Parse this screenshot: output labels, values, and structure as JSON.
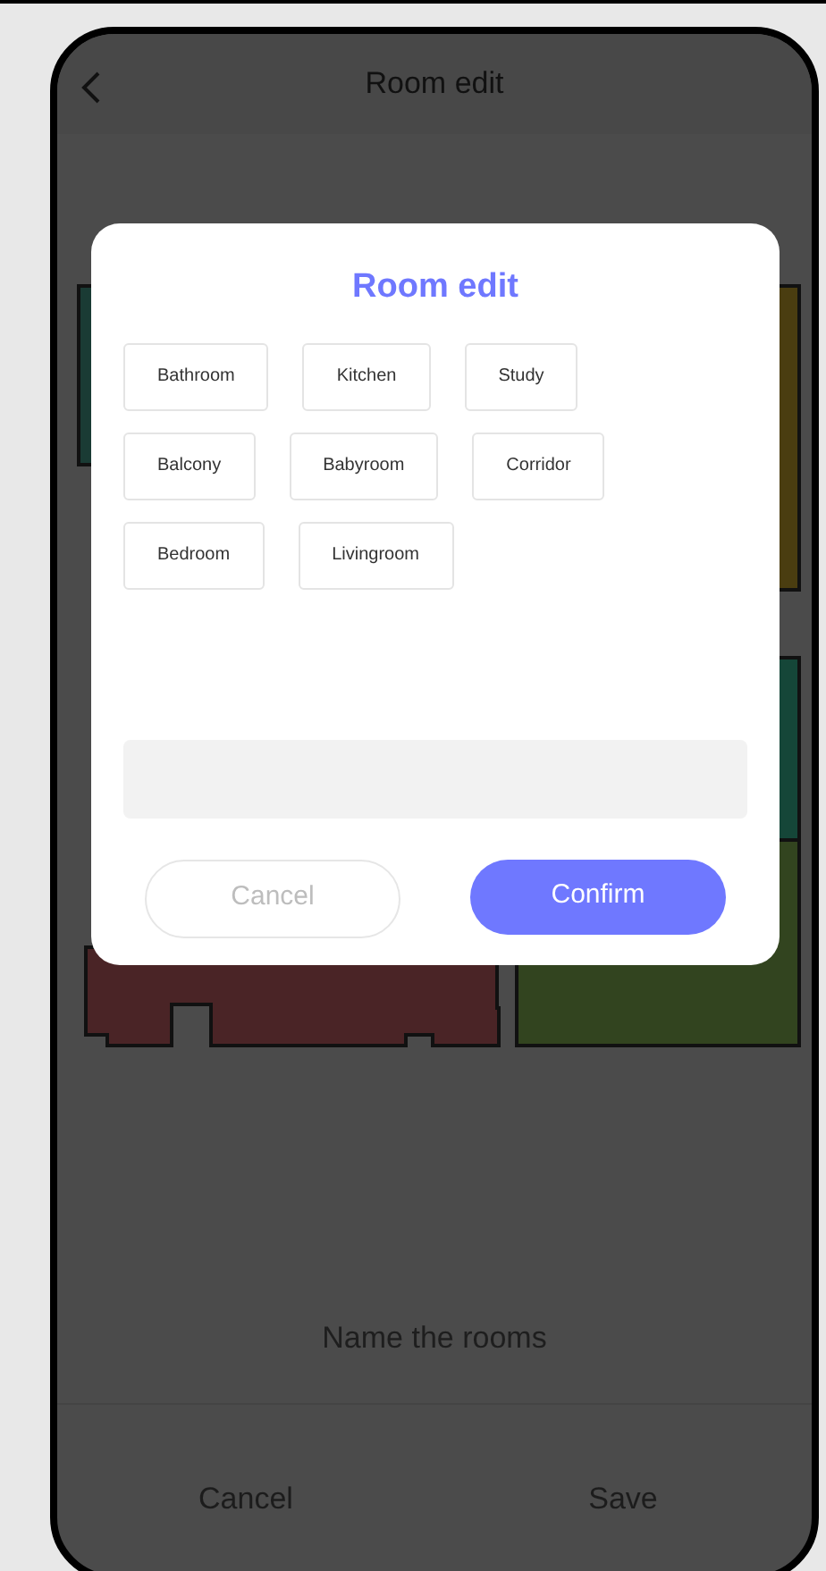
{
  "header": {
    "title": "Room edit"
  },
  "dialog": {
    "title": "Room edit",
    "rooms": [
      {
        "label": "Bathroom"
      },
      {
        "label": "Kitchen"
      },
      {
        "label": "Study"
      },
      {
        "label": "Balcony"
      },
      {
        "label": "Babyroom"
      },
      {
        "label": "Corridor"
      },
      {
        "label": "Bedroom"
      },
      {
        "label": "Livingroom"
      }
    ],
    "cancel": {
      "label": "Cancel",
      "disabled": true
    },
    "confirm": {
      "label": "Confirm"
    }
  },
  "hint": "Name the rooms",
  "footer": {
    "cancel": "Cancel",
    "save": "Save"
  }
}
